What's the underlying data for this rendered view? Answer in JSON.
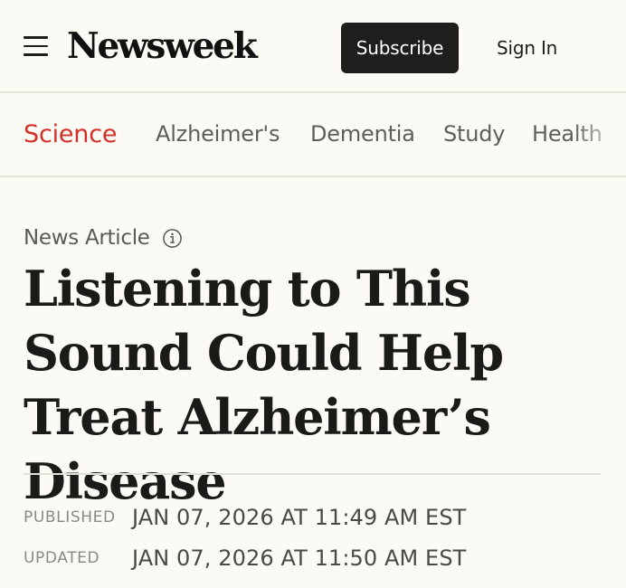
{
  "header": {
    "logo_text": "Newsweek",
    "subscribe_label": "Subscribe",
    "signin_label": "Sign In"
  },
  "subnav": {
    "items": [
      {
        "label": "Science",
        "active": true
      },
      {
        "label": "Alzheimer's"
      },
      {
        "label": "Dementia"
      },
      {
        "label": "Study"
      },
      {
        "label": "Health"
      }
    ]
  },
  "article": {
    "type_label": "News Article",
    "headline": "Listening to This Sound Could Help Treat Alzheimer’s Disease",
    "published_label": "PUBLISHED",
    "published_value": "JAN 07, 2026 AT 11:49 AM EST",
    "updated_label": "UPDATED",
    "updated_value": "JAN 07, 2026 AT 11:50 AM EST"
  },
  "colors": {
    "accent": "#d42f28",
    "button_bg": "#1e1e1c",
    "page_bg": "#fbfaf5"
  },
  "icons": {
    "menu": "hamburger-icon",
    "info": "info-icon"
  }
}
